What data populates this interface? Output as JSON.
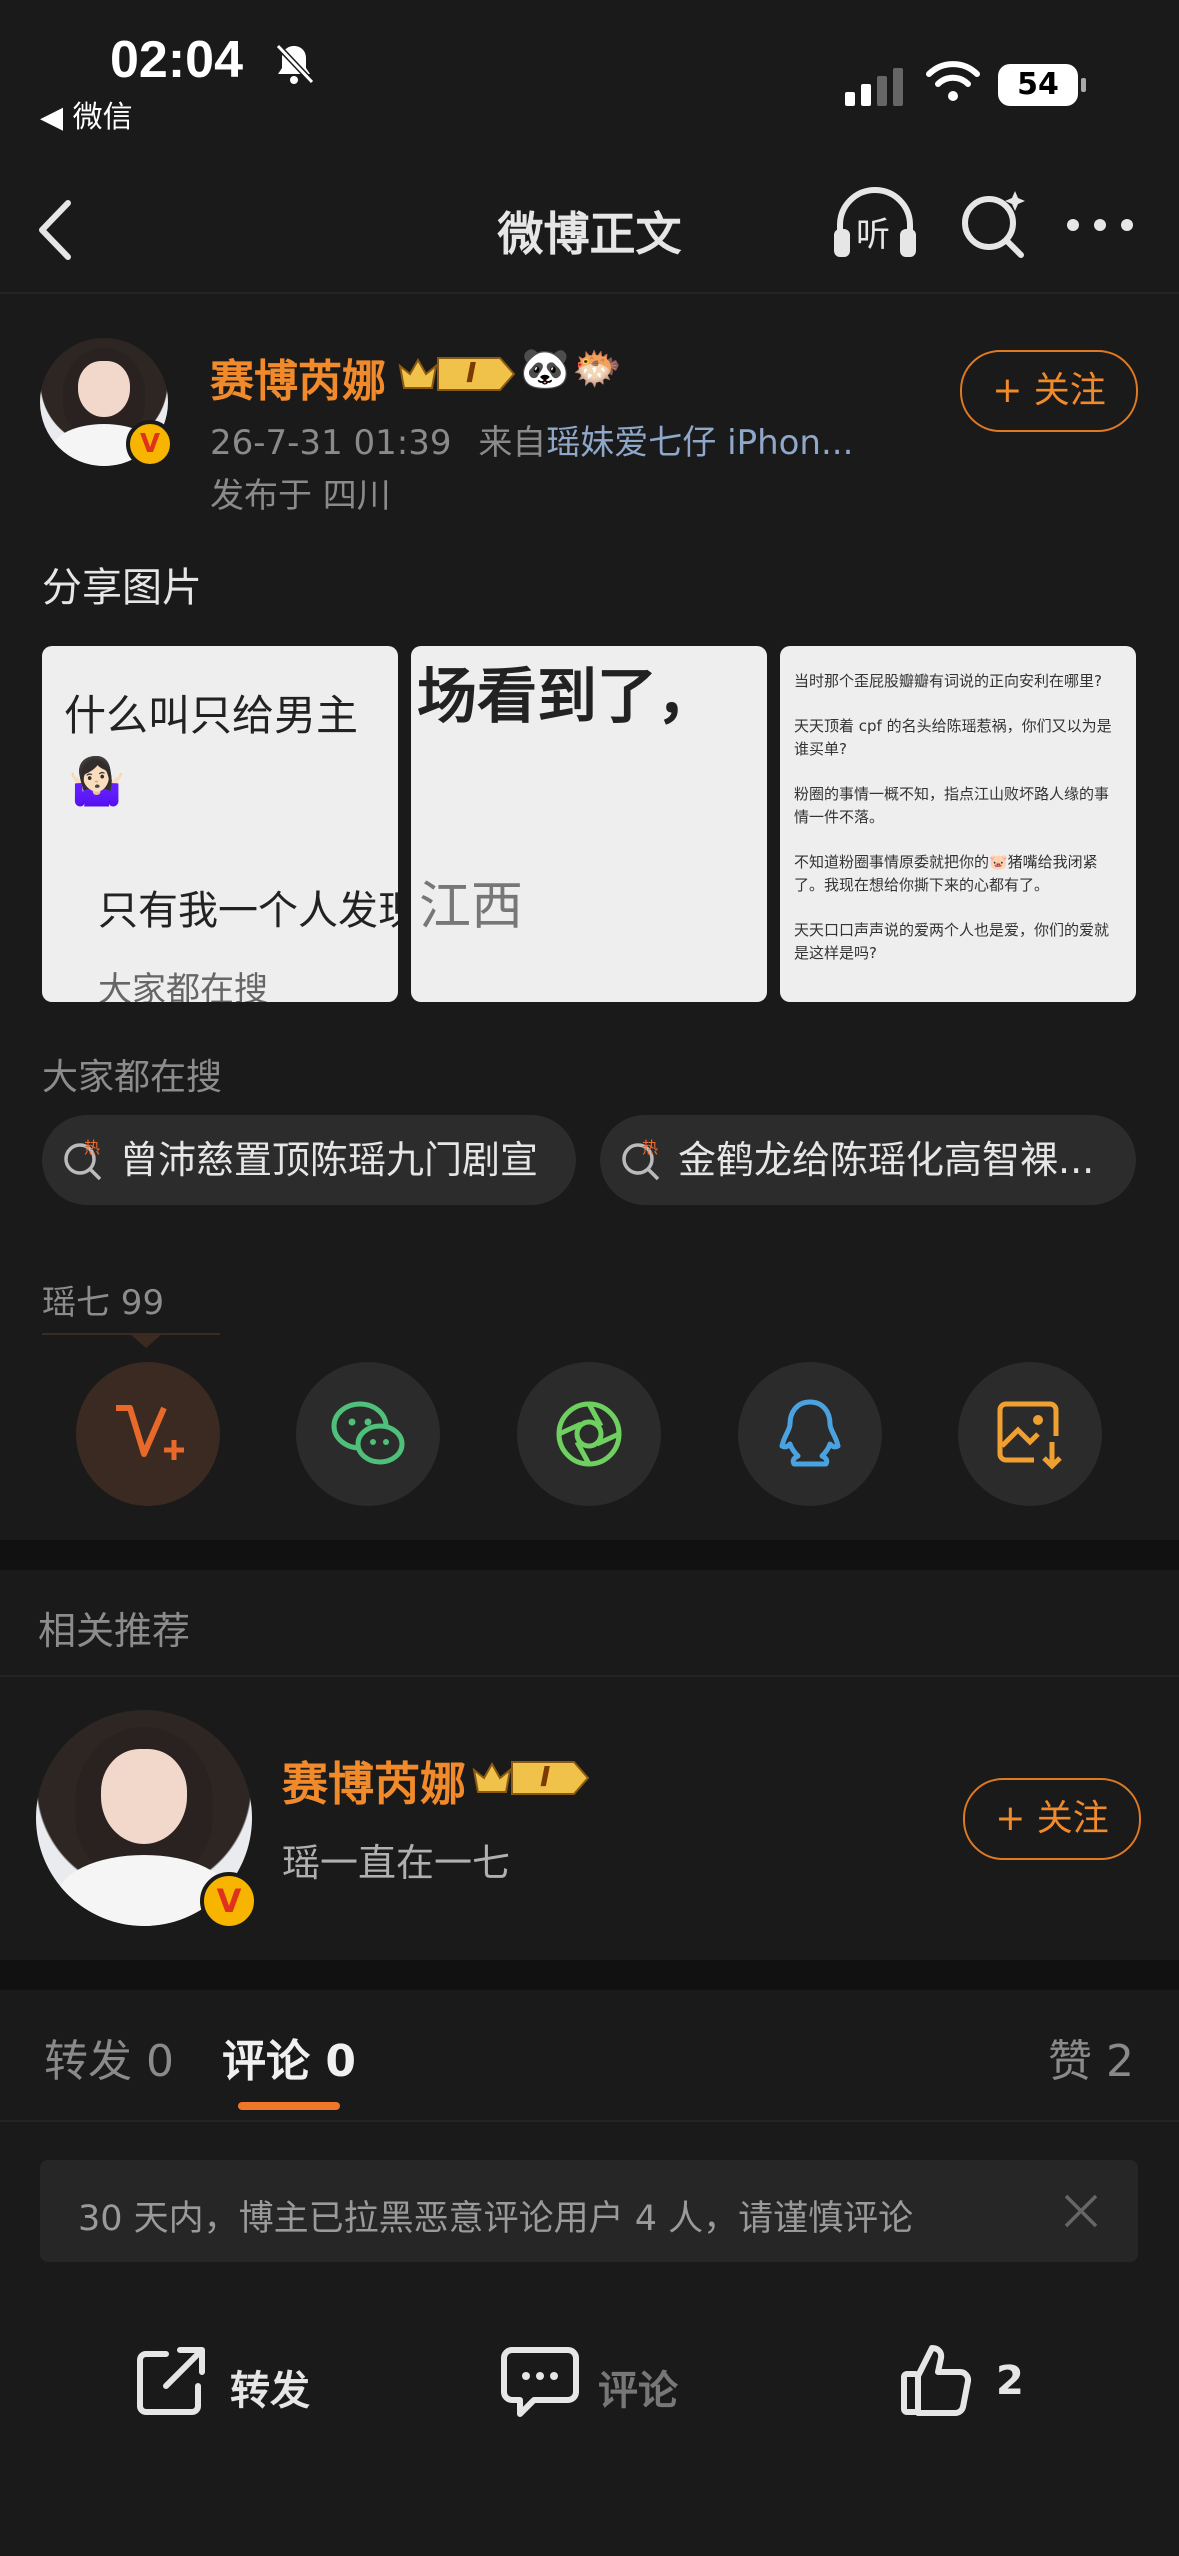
{
  "status_bar": {
    "time": "02:04",
    "back_app": "◀ 微信",
    "battery": "54"
  },
  "nav": {
    "title": "微博正文",
    "listen_label": "听"
  },
  "post": {
    "author": "赛博芮娜",
    "level_badge": "I",
    "emojis": [
      "🐼",
      "🐡"
    ],
    "timestamp": "26-7-31 01:39",
    "source_prefix": "来自",
    "source": "瑶妹爱七仔 iPhon...",
    "location": "发布于 四川",
    "follow_label": "+ 关注",
    "text": "分享图片",
    "images": [
      {
        "line1": "什么叫只给男主",
        "emoji": "🤷🏻‍♀️",
        "line2": "只有我一个人发现",
        "line3": "大家都在搜"
      },
      {
        "line1": "场看到了，",
        "line2": "江西"
      },
      {
        "lines": [
          "当时那个歪屁股瓣瓣有词说的正向安利在哪里?",
          "天天顶着 cpf 的名头给陈瑶惹祸，你们又以为是谁买单?",
          "粉圈的事情一概不知，指点江山败坏路人缘的事情一件不落。",
          "不知道粉圈事情原委就把你的🐷猪嘴给我闭紧了。我现在想给你撕下来的心都有了。",
          "天天口口声声说的爱两个人也是爱，你们的爱就是这样是吗?"
        ]
      }
    ]
  },
  "hot_search": {
    "label": "大家都在搜",
    "items": [
      "曾沛慈置顶陈瑶九门剧宣",
      "金鹤龙给陈瑶化高智裸..."
    ]
  },
  "share": {
    "tag": "瑶七 99",
    "icons": [
      "weibo-v-plus-icon",
      "wechat-icon",
      "moments-icon",
      "qq-icon",
      "save-image-icon"
    ]
  },
  "related": {
    "label": "相关推荐",
    "name": "赛博芮娜",
    "level_badge": "I",
    "desc": "瑶一直在一七",
    "follow_label": "+ 关注"
  },
  "tabs": {
    "repost": "转发 0",
    "comment": "评论 0",
    "like": "赞 2"
  },
  "notice": "30 天内，博主已拉黑恶意评论用户 4 人，请谨慎评论",
  "bottom_bar": {
    "repost": "转发",
    "comment": "评论",
    "like": "2"
  },
  "colors": {
    "accent": "#f08a2a",
    "background": "#1a1a1a"
  }
}
